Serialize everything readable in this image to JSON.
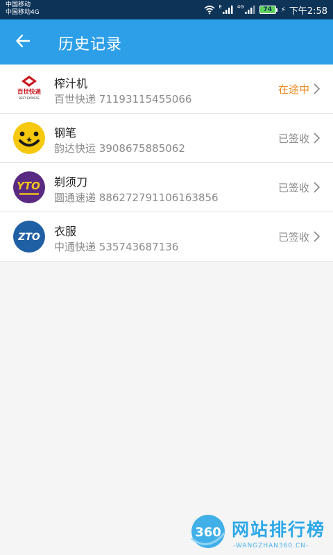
{
  "status_bar": {
    "carrier_1": "中国移动",
    "carrier_2": "中国移动4G",
    "signal_1_tag": "E",
    "signal_2_tag": "4G",
    "battery": "74",
    "time": "下午2:58"
  },
  "app_bar": {
    "back_icon": "arrow-left-icon",
    "title": "历史记录"
  },
  "items": [
    {
      "name": "榨汁机",
      "courier": "百世快递",
      "number": "71193115455066",
      "status": "在途中",
      "status_color": "#f0861a",
      "logo": "best-express-logo"
    },
    {
      "name": "钢笔",
      "courier": "韵达快运",
      "number": "3908675885062",
      "status": "已签收",
      "status_color": "#8a8a8a",
      "logo": "yunda-logo"
    },
    {
      "name": "剃须刀",
      "courier": "圆通速递",
      "number": "886272791106163856",
      "status": "已签收",
      "status_color": "#8a8a8a",
      "logo": "yto-logo"
    },
    {
      "name": "衣服",
      "courier": "中通快递",
      "number": "535743687136",
      "status": "已签收",
      "status_color": "#8a8a8a",
      "logo": "zto-logo"
    }
  ],
  "logo_text": {
    "best": "百世快递",
    "best_en": "BEST EXPRESS",
    "yunda_star": "★",
    "yto": "YTO",
    "zto": "ZTO"
  },
  "watermark": {
    "badge": "360",
    "text": "网站排行榜",
    "url": "-WANGZHAN360.CN-"
  },
  "colors": {
    "status_bar": "#0d3357",
    "app_bar": "#2d9fe8",
    "in_transit": "#f0861a",
    "delivered": "#8a8a8a"
  }
}
